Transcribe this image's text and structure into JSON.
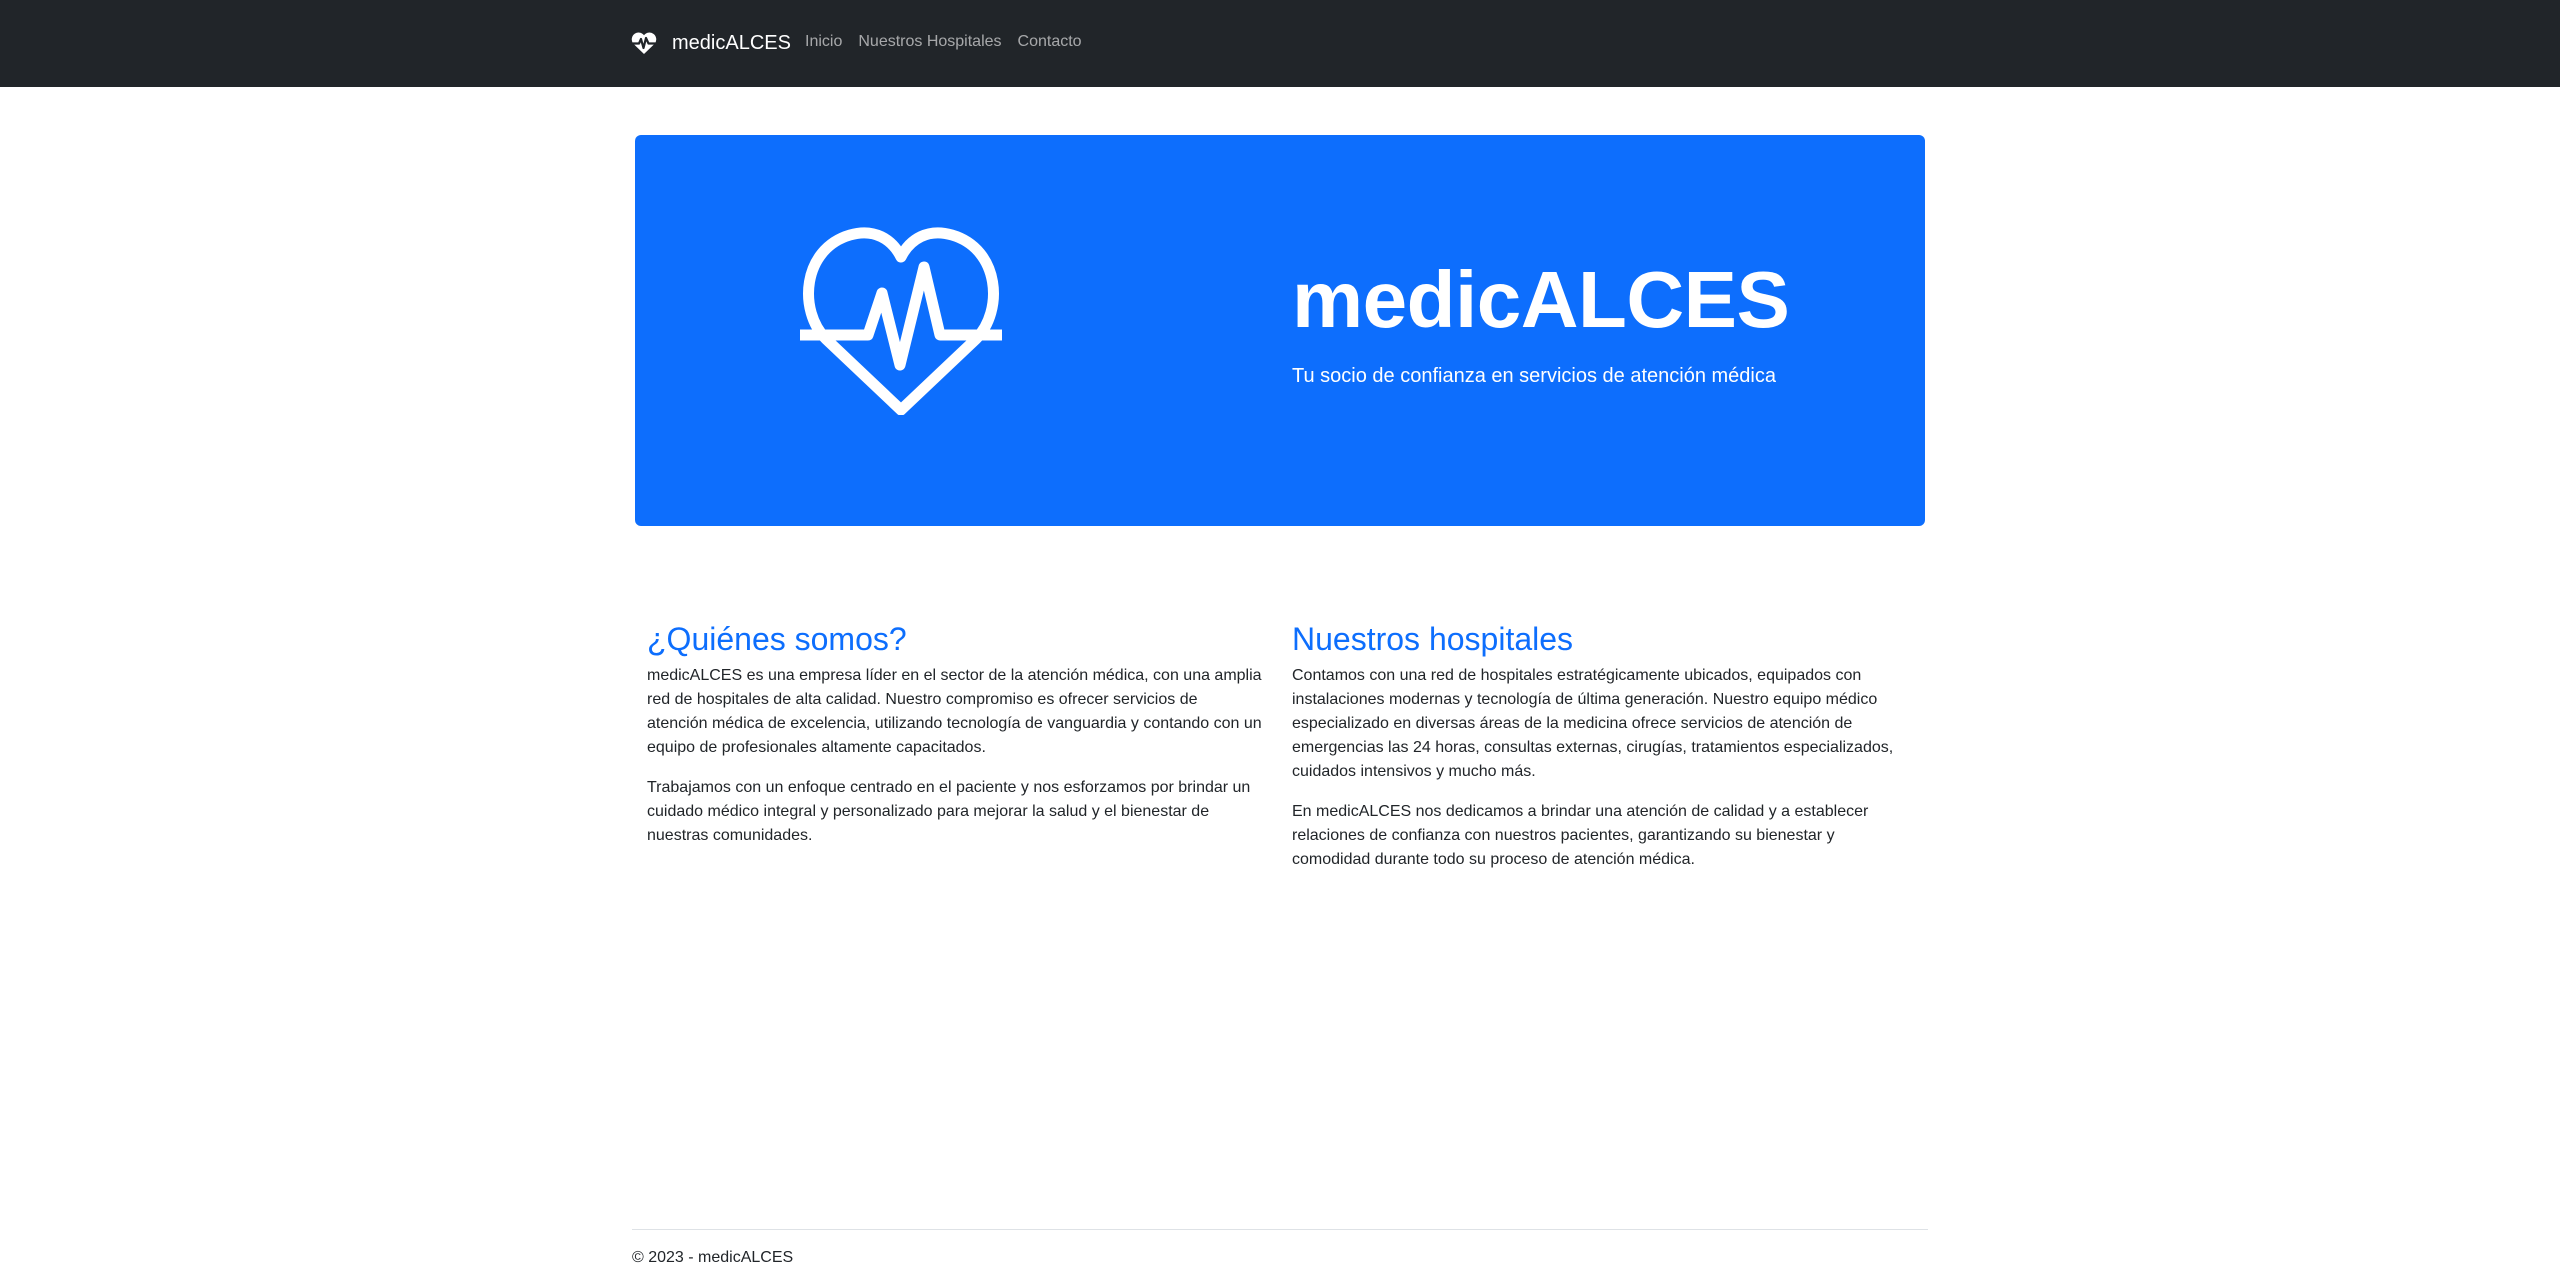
{
  "navbar": {
    "brand_icon": "heart-pulse-icon",
    "brand_name": "medicALCES",
    "links": [
      {
        "label": "Inicio"
      },
      {
        "label": "Nuestros Hospitales"
      },
      {
        "label": "Contacto"
      }
    ]
  },
  "hero": {
    "icon": "heart-pulse-icon",
    "title": "medicALCES",
    "subtitle": "Tu socio de confianza en servicios de atención médica",
    "background": "#0d6efd"
  },
  "about": {
    "heading": "¿Quiénes somos?",
    "paragraphs": [
      "medicALCES es una empresa líder en el sector de la atención médica, con una amplia red de hospitales de alta calidad. Nuestro compromiso es ofrecer servicios de atención médica de excelencia, utilizando tecnología de vanguardia y contando con un equipo de profesionales altamente capacitados.",
      "Trabajamos con un enfoque centrado en el paciente y nos esforzamos por brindar un cuidado médico integral y personalizado para mejorar la salud y el bienestar de nuestras comunidades."
    ]
  },
  "hospitals": {
    "heading": "Nuestros hospitales",
    "paragraphs": [
      "Contamos con una red de hospitales estratégicamente ubicados, equipados con instalaciones modernas y tecnología de última generación. Nuestro equipo médico especializado en diversas áreas de la medicina ofrece servicios de atención de emergencias las 24 horas, consultas externas, cirugías, tratamientos especializados, cuidados intensivos y mucho más.",
      "En medicALCES nos dedicamos a brindar una atención de calidad y a establecer relaciones de confianza con nuestros pacientes, garantizando su bienestar y comodidad durante todo su proceso de atención médica."
    ]
  },
  "footer": {
    "text": "© 2023 - medicALCES"
  },
  "colors": {
    "navbar": "#212529",
    "accent": "#0d6efd",
    "text": "#212529"
  }
}
